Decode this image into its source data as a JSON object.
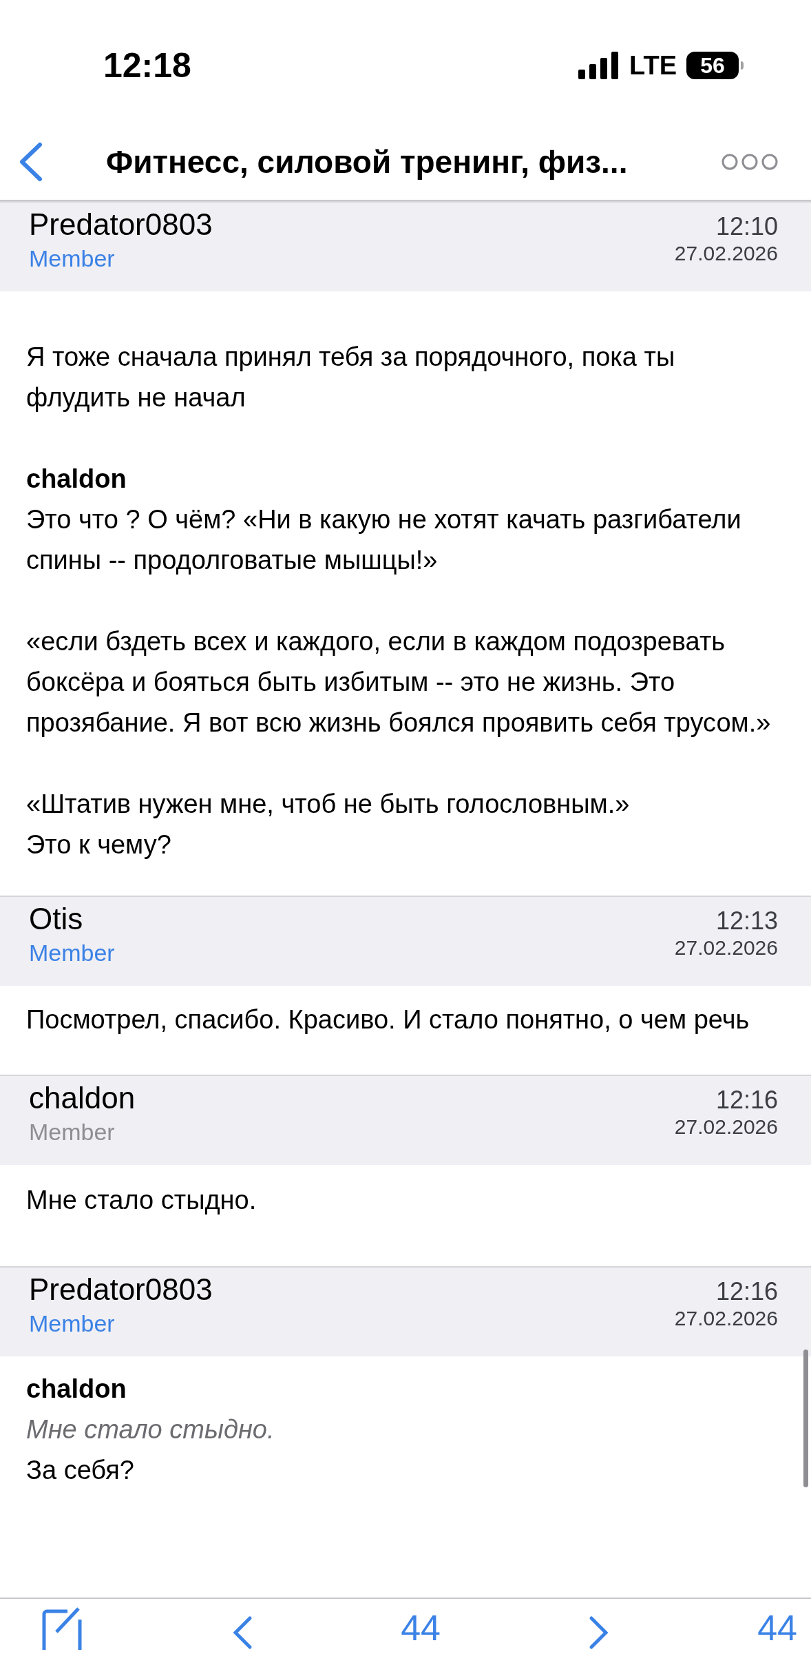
{
  "status_bar": {
    "time": "12:18",
    "network": "LTE",
    "battery": "56"
  },
  "nav": {
    "title": "Фитнесс, силовой тренинг, физ..."
  },
  "posts": [
    {
      "author": "Predator0803",
      "role": "Member",
      "color": "#3b82e6",
      "time": "12:10",
      "date": "27.02.2026",
      "paragraphs": [
        [
          {
            "kind": "text",
            "text": "Я тоже сначала принял тебя за порядочного, пока ты флудить не начал"
          }
        ],
        [
          {
            "kind": "author",
            "text": "chaldon"
          },
          {
            "kind": "text",
            "text": "Это что ? О чём? «Ни в какую не хотят качать разгибатели спины -- продолговатые мышцы!»"
          }
        ],
        [
          {
            "kind": "text",
            "text": "«если бздеть всех и каждого, если в каждом подозревать боксёра и бояться быть избитым -- это не жизнь. Это прозябание. Я вот всю жизнь боялся проявить себя трусом.»"
          }
        ],
        [
          {
            "kind": "text",
            "text": "«Штатив нужен мне, чтоб не быть голословным.»"
          },
          {
            "kind": "text",
            "text": "Это к чему?"
          }
        ]
      ]
    },
    {
      "author": "Otis",
      "role": "Member",
      "color": "#3b82e6",
      "time": "12:13",
      "date": "27.02.2026",
      "paragraphs": [
        [
          {
            "kind": "text",
            "text": "Посмотрел, спасибо. Красиво. И стало понятно, о чем речь"
          }
        ]
      ]
    },
    {
      "author": "chaldon",
      "role": "Member",
      "color": "#8e8e93",
      "time": "12:16",
      "date": "27.02.2026",
      "paragraphs": [
        [
          {
            "kind": "text",
            "text": "Мне стало стыдно."
          }
        ]
      ]
    },
    {
      "author": "Predator0803",
      "role": "Member",
      "color": "#3b82e6",
      "time": "12:16",
      "date": "27.02.2026",
      "paragraphs": [
        [
          {
            "kind": "author",
            "text": "chaldon"
          },
          {
            "kind": "quote",
            "text": "Мне стало стыдно."
          },
          {
            "kind": "text",
            "text": "За себя?"
          }
        ]
      ]
    }
  ],
  "toolbar": {
    "page": "44",
    "total": "44"
  }
}
